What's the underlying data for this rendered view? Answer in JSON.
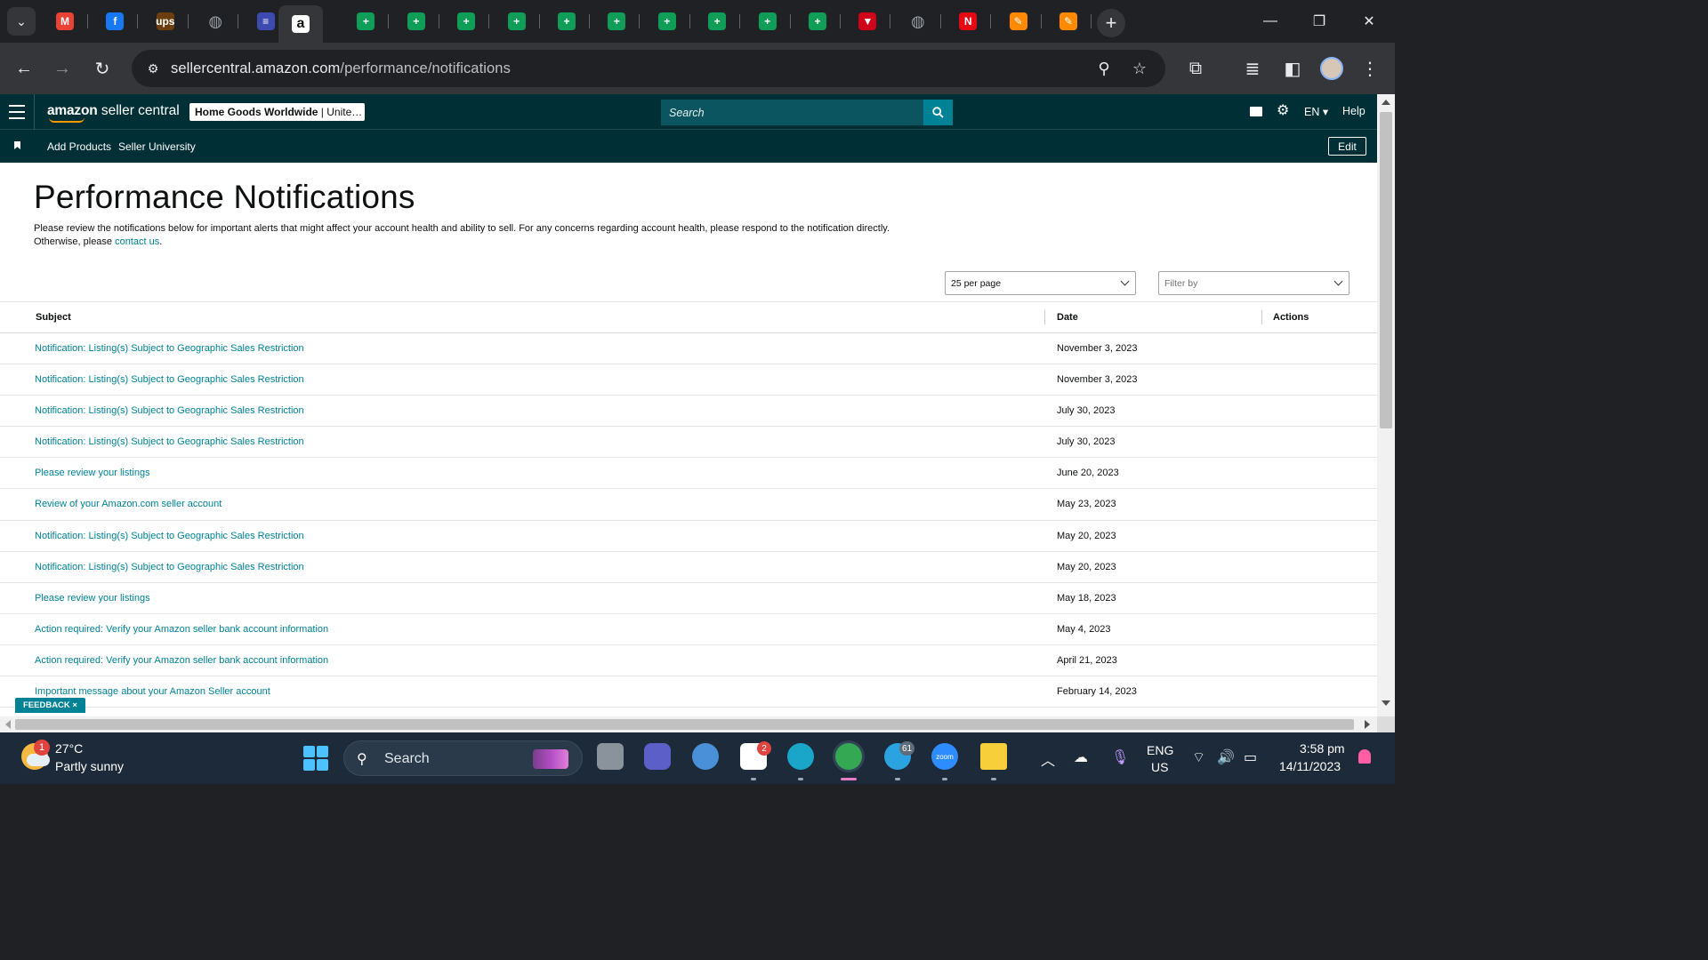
{
  "browser": {
    "tabs": [
      {
        "name": "tab-gmail",
        "color": "#ea4335",
        "glyph": "M"
      },
      {
        "name": "tab-facebook",
        "color": "#1877f2",
        "glyph": "f"
      },
      {
        "name": "tab-ups",
        "color": "#6b3e0f",
        "glyph": "ups"
      },
      {
        "name": "tab-globe",
        "color": "#9aa0a6",
        "glyph": "◍"
      },
      {
        "name": "tab-flag",
        "color": "#3d4ab0",
        "glyph": "≡"
      },
      {
        "name": "tab-amazon",
        "color": "#ffffff",
        "glyph": "a",
        "active": true
      },
      {
        "name": "tab-sheets-1",
        "color": "#0f9d58",
        "glyph": "+"
      },
      {
        "name": "tab-sheets-2",
        "color": "#0f9d58",
        "glyph": "+"
      },
      {
        "name": "tab-sheets-3",
        "color": "#0f9d58",
        "glyph": "+"
      },
      {
        "name": "tab-sheets-4",
        "color": "#0f9d58",
        "glyph": "+"
      },
      {
        "name": "tab-sheets-5",
        "color": "#0f9d58",
        "glyph": "+"
      },
      {
        "name": "tab-sheets-6",
        "color": "#0f9d58",
        "glyph": "+"
      },
      {
        "name": "tab-sheets-7",
        "color": "#0f9d58",
        "glyph": "+"
      },
      {
        "name": "tab-sheets-8",
        "color": "#0f9d58",
        "glyph": "+"
      },
      {
        "name": "tab-sheets-9",
        "color": "#0f9d58",
        "glyph": "+"
      },
      {
        "name": "tab-sheets-10",
        "color": "#0f9d58",
        "glyph": "+"
      },
      {
        "name": "tab-red-arrow",
        "color": "#d0021b",
        "glyph": "▼"
      },
      {
        "name": "tab-globe-2",
        "color": "#9aa0a6",
        "glyph": "◍"
      },
      {
        "name": "tab-netflix",
        "color": "#e50914",
        "glyph": "N"
      },
      {
        "name": "tab-app-1",
        "color": "#ff8a00",
        "glyph": "✎"
      },
      {
        "name": "tab-app-2",
        "color": "#ff8a00",
        "glyph": "✎"
      }
    ],
    "url_host": "sellercentral.amazon.com",
    "url_path": "/performance/notifications"
  },
  "header": {
    "logo_brand": "amazon",
    "logo_product": "seller central",
    "store_name": "Home Goods Worldwide",
    "store_region": " | Unite…",
    "search_placeholder": "Search",
    "language": "EN",
    "help": "Help"
  },
  "subnav": {
    "add_products": "Add Products",
    "seller_university": "Seller University",
    "edit": "Edit"
  },
  "main": {
    "title": "Performance Notifications",
    "description": "Please review the notifications below for important alerts that might affect your account health and ability to sell. For any concerns regarding account health, please respond to the notification directly. Otherwise, please ",
    "contact_link": "contact us",
    "description_end": ".",
    "per_page": "25 per page",
    "filter_placeholder": "Filter by",
    "columns": {
      "subject": "Subject",
      "date": "Date",
      "actions": "Actions"
    },
    "rows": [
      {
        "subject": "Notification: Listing(s) Subject to Geographic Sales Restriction",
        "date": "November 3, 2023"
      },
      {
        "subject": "Notification: Listing(s) Subject to Geographic Sales Restriction",
        "date": "November 3, 2023"
      },
      {
        "subject": "Notification: Listing(s) Subject to Geographic Sales Restriction",
        "date": "July 30, 2023"
      },
      {
        "subject": "Notification: Listing(s) Subject to Geographic Sales Restriction",
        "date": "July 30, 2023"
      },
      {
        "subject": "Please review your listings",
        "date": "June 20, 2023"
      },
      {
        "subject": "Review of your Amazon.com seller account",
        "date": "May 23, 2023"
      },
      {
        "subject": "Notification: Listing(s) Subject to Geographic Sales Restriction",
        "date": "May 20, 2023"
      },
      {
        "subject": "Notification: Listing(s) Subject to Geographic Sales Restriction",
        "date": "May 20, 2023"
      },
      {
        "subject": "Please review your listings",
        "date": "May 18, 2023"
      },
      {
        "subject": "Action required: Verify your Amazon seller bank account information",
        "date": "May 4, 2023"
      },
      {
        "subject": "Action required: Verify your Amazon seller bank account information",
        "date": "April 21, 2023"
      },
      {
        "subject": "Important message about your Amazon Seller account",
        "date": "February 14, 2023"
      }
    ],
    "feedback": "FEEDBACK ×"
  },
  "taskbar": {
    "weather_badge": "1",
    "temperature": "27°C",
    "condition": "Partly sunny",
    "search": "Search",
    "slack_badge": "2",
    "telegram_badge": "61",
    "zoom_label": "zoom",
    "lang_line1": "ENG",
    "lang_line2": "US",
    "time": "3:58 pm",
    "date": "14/11/2023"
  },
  "colors": {
    "amazon_header": "#002f36",
    "link": "#008296",
    "search_button": "#008296"
  }
}
